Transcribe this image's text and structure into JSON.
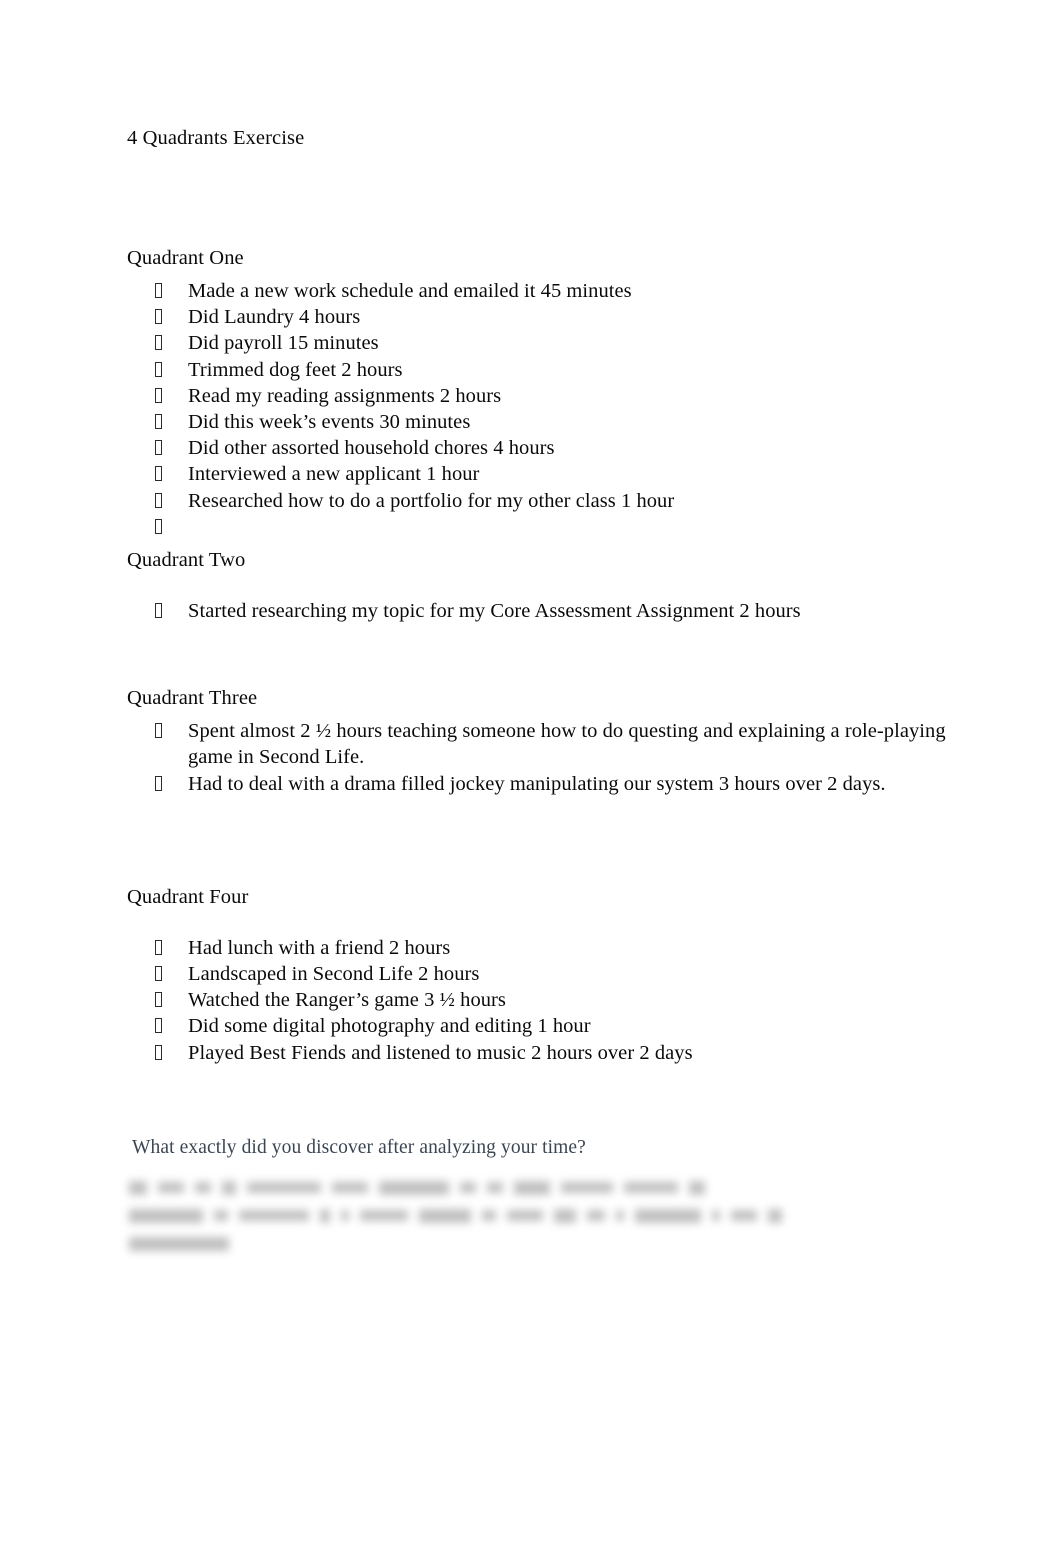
{
  "document": {
    "title": "4 Quadrants Exercise",
    "sections": [
      {
        "heading": "Quadrant One",
        "items": [
          "Made a new work schedule and emailed it   45 minutes",
          "Did Laundry 4 hours",
          "Did payroll      15 minutes",
          "Trimmed dog feet 2 hours",
          "Read my reading assignments 2 hours",
          "Did this week’s events 30 minutes",
          "Did other assorted household chores 4 hours",
          "Interviewed a new applicant 1 hour",
          "Researched how to do a portfolio for my other class 1 hour",
          ""
        ]
      },
      {
        "heading": "Quadrant Two",
        "items": [
          "Started researching my topic for my Core Assessment Assignment 2 hours"
        ]
      },
      {
        "heading": "Quadrant Three",
        "items": [
          "Spent almost 2 ½ hours teaching someone how to do questing and explaining a role-playing game in Second Life.",
          "Had to deal with a drama filled jockey manipulating our system 3 hours over 2 days."
        ]
      },
      {
        "heading": "Quadrant Four",
        "items": [
          "Had lunch with a friend 2 hours",
          "Landscaped in Second Life 2 hours",
          "Watched the Ranger’s game 3 ½ hours",
          "Did some digital photography and editing 1 hour",
          "Played Best Fiends and listened to music 2 hours over 2 days"
        ]
      }
    ],
    "question": " What exactly did you discover after analyzing your time?",
    "answer_redacted": {
      "legible": false,
      "note": "blurred illegible text",
      "line_widths": [
        [
          18,
          26,
          16,
          14,
          74,
          36,
          70,
          16,
          16,
          36,
          52,
          54,
          16
        ],
        [
          74,
          14,
          70,
          10,
          8,
          48,
          52,
          14,
          36,
          22,
          18,
          8,
          66,
          8,
          26,
          14
        ],
        [
          100
        ]
      ]
    },
    "colors": {
      "body_text": "#0a0a0a",
      "question_text": "#3b4654",
      "page_background": "#ffffff",
      "bullet_marker": "#2b2b2b"
    }
  }
}
